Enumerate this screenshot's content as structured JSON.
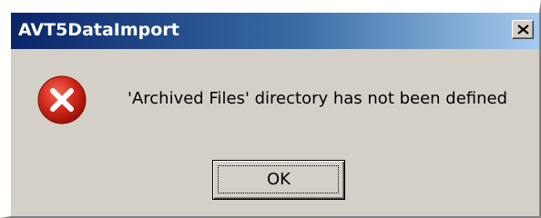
{
  "window": {
    "title": "AVT5DataImport"
  },
  "dialog": {
    "icon": "error-icon",
    "message": "'Archived Files' directory has not been defined",
    "ok_label": "OK"
  },
  "colors": {
    "titlebar_start": "#0a246a",
    "titlebar_end": "#a6caf0",
    "dialog_background": "#d4d0c8",
    "error_red": "#cc1a1a"
  }
}
